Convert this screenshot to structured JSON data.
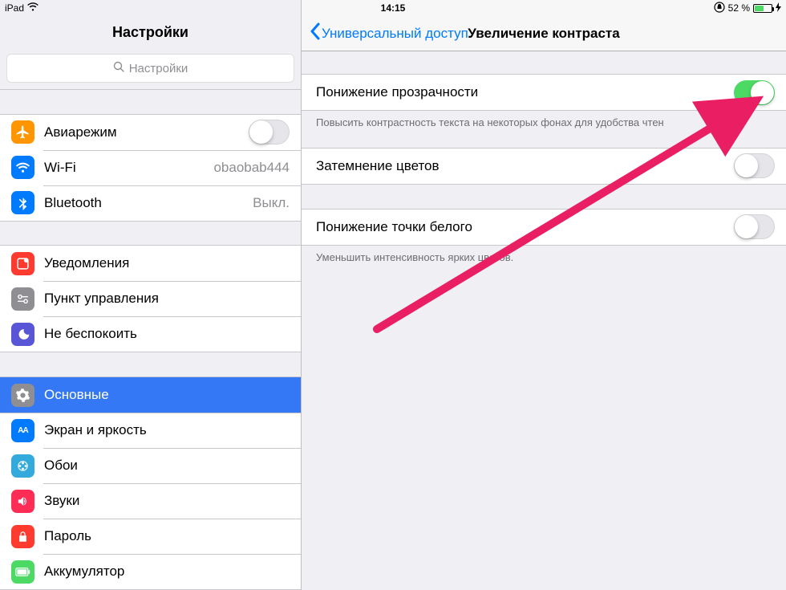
{
  "statusbar": {
    "device": "iPad",
    "time": "14:15",
    "battery_text": "52 %"
  },
  "sidebar": {
    "title": "Настройки",
    "search_placeholder": "Настройки",
    "groups": [
      {
        "rows": [
          {
            "id": "airplane",
            "label": "Авиарежим",
            "type": "switch",
            "switch_on": false,
            "icon_color": "#ff9500"
          },
          {
            "id": "wifi",
            "label": "Wi-Fi",
            "type": "value",
            "value": "obaobab444",
            "icon_color": "#007aff"
          },
          {
            "id": "bluetooth",
            "label": "Bluetooth",
            "type": "value",
            "value": "Выкл.",
            "icon_color": "#007aff"
          }
        ]
      },
      {
        "rows": [
          {
            "id": "notifications",
            "label": "Уведомления",
            "type": "nav",
            "icon_color": "#ff3b30"
          },
          {
            "id": "controlcenter",
            "label": "Пункт управления",
            "type": "nav",
            "icon_color": "#8e8e93"
          },
          {
            "id": "dnd",
            "label": "Не беспокоить",
            "type": "nav",
            "icon_color": "#5856d6"
          }
        ]
      },
      {
        "rows": [
          {
            "id": "general",
            "label": "Основные",
            "type": "nav",
            "selected": true,
            "icon_color": "#8e8e93"
          },
          {
            "id": "display",
            "label": "Экран и яркость",
            "type": "nav",
            "icon_color": "#007aff"
          },
          {
            "id": "wallpaper",
            "label": "Обои",
            "type": "nav",
            "icon_color": "#55c1c8"
          },
          {
            "id": "sounds",
            "label": "Звуки",
            "type": "nav",
            "icon_color": "#ff2d55"
          },
          {
            "id": "passcode",
            "label": "Пароль",
            "type": "nav",
            "icon_color": "#ff3b30"
          },
          {
            "id": "battery",
            "label": "Аккумулятор",
            "type": "nav",
            "icon_color": "#4cd964"
          }
        ]
      }
    ]
  },
  "detail": {
    "back_label": "Универсальный доступ",
    "title": "Увеличение контраста",
    "sections": [
      {
        "rows": [
          {
            "id": "reduce-transparency",
            "label": "Понижение прозрачности",
            "switch_on": true
          }
        ],
        "footer": "Повысить контрастность текста на некоторых фонах для удобства чтен"
      },
      {
        "rows": [
          {
            "id": "darken-colors",
            "label": "Затемнение цветов",
            "switch_on": false
          }
        ]
      },
      {
        "rows": [
          {
            "id": "reduce-white-point",
            "label": "Понижение точки белого",
            "switch_on": false
          }
        ],
        "footer": "Уменьшить интенсивность ярких цветов."
      }
    ]
  }
}
